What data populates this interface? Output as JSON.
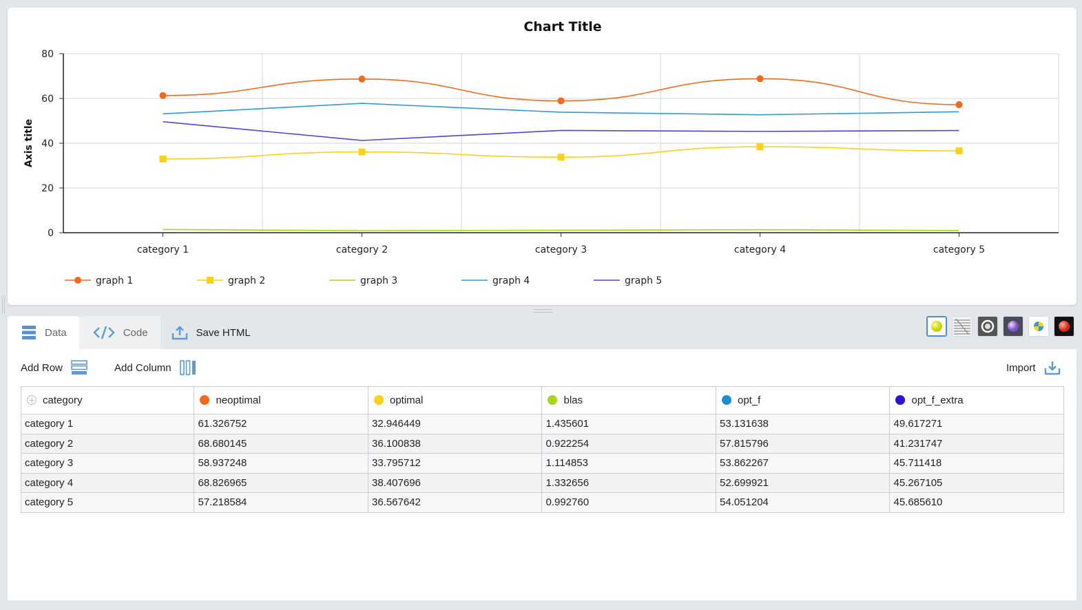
{
  "chart_data": {
    "type": "line",
    "title": "Chart Title",
    "ylabel": "Axis title",
    "xlabel": "",
    "categories": [
      "category 1",
      "category 2",
      "category 3",
      "category 4",
      "category 5"
    ],
    "ylim": [
      0,
      80
    ],
    "yticks": [
      0,
      20,
      40,
      60,
      80
    ],
    "grid": true,
    "legend_position": "bottom-left",
    "series": [
      {
        "name": "graph 1",
        "color": "#f26a1b",
        "marker": "circle",
        "smooth": true,
        "values": [
          61.326752,
          68.680145,
          58.937248,
          68.826965,
          57.218584
        ]
      },
      {
        "name": "graph 2",
        "color": "#fcd116",
        "marker": "square",
        "smooth": true,
        "values": [
          32.946449,
          36.100838,
          33.795712,
          38.407696,
          36.567642
        ]
      },
      {
        "name": "graph 3",
        "color": "#a6d61e",
        "marker": "none",
        "smooth": true,
        "values": [
          1.435601,
          0.922254,
          1.114853,
          1.332656,
          0.99276
        ]
      },
      {
        "name": "graph 4",
        "color": "#2e9ad6",
        "marker": "none",
        "smooth": false,
        "values": [
          53.131638,
          57.815796,
          53.862267,
          52.699921,
          54.051204
        ]
      },
      {
        "name": "graph 5",
        "color": "#5a3ed6",
        "marker": "none",
        "smooth": false,
        "values": [
          49.617271,
          41.231747,
          45.711418,
          45.267105,
          45.68561
        ]
      }
    ]
  },
  "tabs": {
    "data": "Data",
    "code": "Code",
    "save": "Save HTML"
  },
  "theme_buttons": [
    "yellow-ball-theme",
    "stripes-theme",
    "ring-theme",
    "purple-ball-theme",
    "blue-yellow-theme",
    "red-ball-theme"
  ],
  "toolbar": {
    "add_row": "Add Row",
    "add_column": "Add Column",
    "import": "Import"
  },
  "table": {
    "columns": [
      {
        "label": "category",
        "color": ""
      },
      {
        "label": "neoptimal",
        "color": "#f26a1b"
      },
      {
        "label": "optimal",
        "color": "#fcd116"
      },
      {
        "label": "blas",
        "color": "#a6d61e"
      },
      {
        "label": "opt_f",
        "color": "#1f8dd6"
      },
      {
        "label": "opt_f_extra",
        "color": "#2a12d6"
      }
    ],
    "rows": [
      [
        "category 1",
        "61.326752",
        "32.946449",
        "1.435601",
        "53.131638",
        "49.617271"
      ],
      [
        "category 2",
        "68.680145",
        "36.100838",
        "0.922254",
        "57.815796",
        "41.231747"
      ],
      [
        "category 3",
        "58.937248",
        "33.795712",
        "1.114853",
        "53.862267",
        "45.711418"
      ],
      [
        "category 4",
        "68.826965",
        "38.407696",
        "1.332656",
        "52.699921",
        "45.267105"
      ],
      [
        "category 5",
        "57.218584",
        "36.567642",
        "0.992760",
        "54.051204",
        "45.685610"
      ]
    ]
  }
}
